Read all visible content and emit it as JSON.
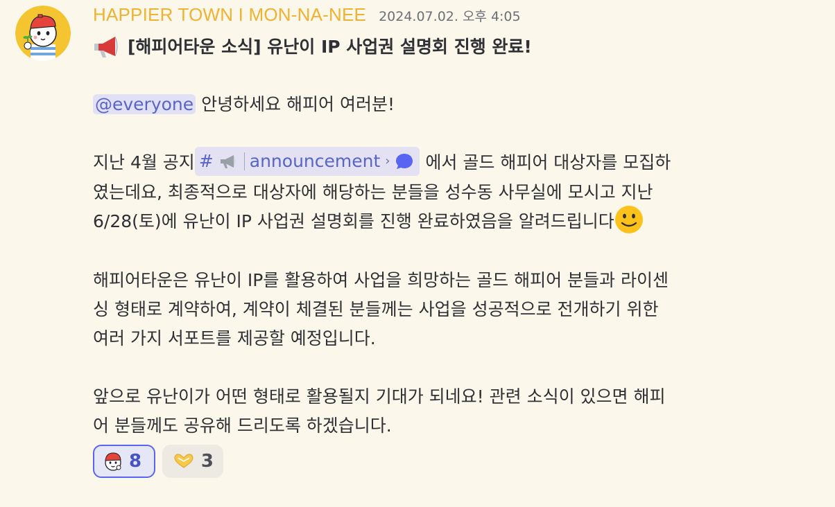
{
  "message": {
    "author": "HAPPIER TOWN I MON-NA-NEE",
    "timestamp": "2024.07.02. 오후 4:05",
    "author_color": "#f0b232",
    "avatar_icon": "boy-with-red-cap-avatar",
    "title": "[해피어타운 소식] 유난이 IP 사업권 설명회 진행 완료!",
    "title_icon": "megaphone-icon",
    "greeting": {
      "mention": "@everyone",
      "text": " 안녕하세요 해피어 여러분!"
    },
    "paragraph1": {
      "prefix": "지난 4월 공지",
      "channel_hash": "#",
      "channel_name": "announcement",
      "channel_chevron": "›",
      "suffix": " 에서 골드 해피어 대상자를 모집하",
      "line2": "였는데요, 최종적으로 대상자에 해당하는 분들을 성수동 사무실에 모시고 지난",
      "line3": "6/28(토)에 유난이 IP 사업권 설명회를 진행 완료하였음을 알려드립니다"
    },
    "paragraph2": {
      "line1": "해피어타운은 유난이 IP를 활용하여 사업을 희망하는 골드 해피어 분들과 라이센",
      "line2": "싱 형태로 계약하여, 계약이 체결된 분들께는 사업을 성공적으로 전개하기 위한",
      "line3": "여러 가지 서포트를 제공할 예정입니다."
    },
    "paragraph3": {
      "line1": "앞으로 유난이가 어떤 형태로 활용될지 기대가 되네요! 관련 소식이 있으면 해피",
      "line2": "어 분들께도 공유해 드리도록 하겠습니다."
    }
  },
  "reactions": [
    {
      "icon": "boy-face-emoji",
      "count": "8",
      "active": true
    },
    {
      "icon": "heart-hands-emoji",
      "count": "3",
      "active": false
    }
  ],
  "colors": {
    "background": "#fbf7ea",
    "mention_text": "#5865c5",
    "mention_bg": "#e1e0f4",
    "active_reaction_border": "#5865f2"
  }
}
